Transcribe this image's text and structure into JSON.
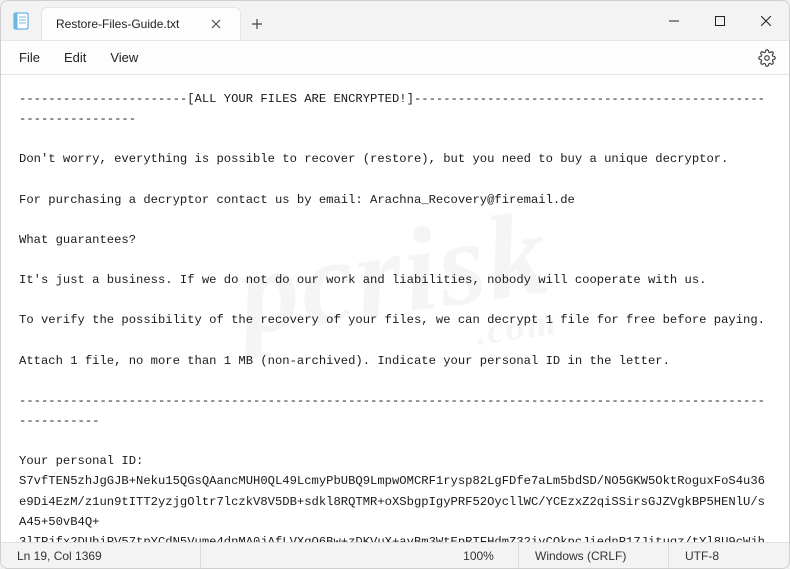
{
  "window": {
    "tab_title": "Restore-Files-Guide.txt"
  },
  "menu": {
    "file": "File",
    "edit": "Edit",
    "view": "View"
  },
  "document": {
    "text": "-----------------------[ALL YOUR FILES ARE ENCRYPTED!]----------------------------------------------------------------\n\nDon't worry, everything is possible to recover (restore), but you need to buy a unique decryptor.\n\nFor purchasing a decryptor contact us by email: Arachna_Recovery@firemail.de\n\nWhat guarantees?\n\nIt's just a business. If we do not do our work and liabilities, nobody will cooperate with us.\n\nTo verify the possibility of the recovery of your files, we can decrypt 1 file for free before paying.\n\nAttach 1 file, no more than 1 MB (non-archived). Indicate your personal ID in the letter.\n\n-----------------------------------------------------------------------------------------------------------------\n\nYour personal ID:\nS7vfTEN5zhJgGJB+Neku15QGsQAancMUH0QL49LcmyPbUBQ9LmpwOMCRF1rysp82LgFDfe7aLm5bdSD/NO5GKW5OktRoguxFoS4u36e9Di4EzM/z1un9tITT2yzjgOltr7lczkV8V5DB+sdkl8RQTMR+oXSbgpIgyPRF52OycllWC/YCEzxZ2qiSSirsGJZVgkBP5HENlU/sA45+50vB4Q+\n3lTPjfx2DUhiPV57tpYCdN5Vume4dnMA0jAfLVXqQ6Bw+zDKVuX+avBm3WtEpRTFHdmZ32ivCQkpcJiednP17Jituqz/tYl8U9cWjheOSmA9cqo1a+r7THHE+TBj5D6/oU9c6yPNoMPfFd4dnxheEdrFbwaOZHSxj9Ubu5nJDtIMwFzTst6qPFNtmxeOsTwwnehIaA2IrKPzDGo2tqi7Op6gCmP5LSHtCB3bk32ShGKO6mEq0YzaeLnbzT92qqhWoJQJIFVatbuMi4dJ2pYBRr3dB7ADEizQWEN"
  },
  "status": {
    "cursor": "Ln 19, Col 1369",
    "zoom": "100%",
    "eol": "Windows (CRLF)",
    "encoding": "UTF-8"
  },
  "watermark": {
    "main": "pcrisk",
    "sub": ".com"
  }
}
